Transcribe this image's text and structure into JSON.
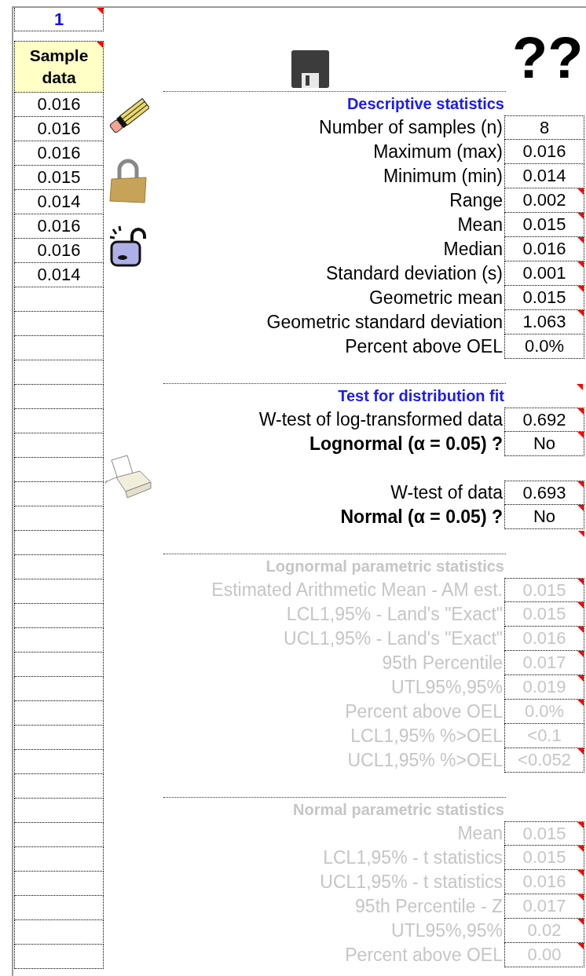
{
  "index_cell": {
    "text": "1",
    "note_marker": true
  },
  "sample_column": {
    "header": "Sample data",
    "note_marker": true,
    "values": [
      "0.016",
      "0.016",
      "0.016",
      "0.015",
      "0.014",
      "0.016",
      "0.016",
      "0.014"
    ]
  },
  "help_label": "??",
  "sections": [
    {
      "title": "Descriptive statistics",
      "disabled": false,
      "note_marker": false,
      "rows": [
        {
          "kind": "stat",
          "label": "Number of samples (n)",
          "value": "8",
          "note_marker": false
        },
        {
          "kind": "stat",
          "label": "Maximum (max)",
          "value": "0.016",
          "note_marker": false
        },
        {
          "kind": "stat",
          "label": "Minimum (min)",
          "value": "0.014",
          "note_marker": false
        },
        {
          "kind": "stat",
          "label": "Range",
          "value": "0.002",
          "note_marker": true
        },
        {
          "kind": "stat",
          "label": "Mean",
          "value": "0.015",
          "note_marker": true
        },
        {
          "kind": "stat",
          "label": "Median",
          "value": "0.016",
          "note_marker": true
        },
        {
          "kind": "stat",
          "label": "Standard deviation (s)",
          "value": "0.001",
          "note_marker": true
        },
        {
          "kind": "stat",
          "label": "Geometric mean",
          "value": "0.015",
          "note_marker": true
        },
        {
          "kind": "stat",
          "label": "Geometric standard deviation",
          "value": "1.063",
          "note_marker": true
        },
        {
          "kind": "stat",
          "label": "Percent above OEL",
          "value": "0.0%",
          "note_marker": false
        },
        {
          "kind": "blank"
        }
      ]
    },
    {
      "title": "Test for distribution fit",
      "disabled": false,
      "note_marker": true,
      "rows": [
        {
          "kind": "stat",
          "label": "W-test of log-transformed data",
          "value": "0.692",
          "note_marker": true
        },
        {
          "kind": "result",
          "label": "Lognormal (α = 0.05) ?",
          "value": "No",
          "note_marker": true
        },
        {
          "kind": "blank"
        },
        {
          "kind": "stat",
          "label": "W-test of data",
          "value": "0.693",
          "note_marker": true
        },
        {
          "kind": "result",
          "label": "Normal (α = 0.05) ?",
          "value": "No",
          "note_marker": true
        },
        {
          "kind": "blank",
          "note_marker": true
        }
      ]
    },
    {
      "title": "Lognormal parametric statistics",
      "disabled": true,
      "note_marker": false,
      "rows": [
        {
          "kind": "stat",
          "label": "Estimated Arithmetic Mean - AM est.",
          "value": "0.015",
          "note_marker": true
        },
        {
          "kind": "stat",
          "label": "LCL1,95% - Land's \"Exact\"",
          "value": "0.015",
          "note_marker": true
        },
        {
          "kind": "stat",
          "label": "UCL1,95% - Land's \"Exact\"",
          "value": "0.016",
          "note_marker": true
        },
        {
          "kind": "stat",
          "label": "95th Percentile",
          "value": "0.017",
          "note_marker": true
        },
        {
          "kind": "stat",
          "label": "UTL95%,95%",
          "value": "0.019",
          "note_marker": true
        },
        {
          "kind": "stat",
          "label": "Percent above OEL",
          "value": "0.0%",
          "note_marker": true
        },
        {
          "kind": "stat",
          "label": "LCL1,95% %>OEL",
          "value": "<0.1",
          "note_marker": false
        },
        {
          "kind": "stat",
          "label": "UCL1,95% %>OEL",
          "value": "<0.052",
          "note_marker": true
        },
        {
          "kind": "blank"
        }
      ]
    },
    {
      "title": "Normal parametric statistics",
      "disabled": true,
      "note_marker": false,
      "rows": [
        {
          "kind": "stat",
          "label": "Mean",
          "value": "0.015",
          "note_marker": true
        },
        {
          "kind": "stat",
          "label": "LCL1,95% - t statistics",
          "value": "0.015",
          "note_marker": true
        },
        {
          "kind": "stat",
          "label": "UCL1,95% - t statistics",
          "value": "0.016",
          "note_marker": true
        },
        {
          "kind": "stat",
          "label": "95th Percentile - Z",
          "value": "0.017",
          "note_marker": true
        },
        {
          "kind": "stat",
          "label": "UTL95%,95%",
          "value": "0.02",
          "note_marker": true
        },
        {
          "kind": "stat",
          "label": "Percent above OEL",
          "value": "0.00",
          "note_marker": true
        }
      ]
    }
  ]
}
